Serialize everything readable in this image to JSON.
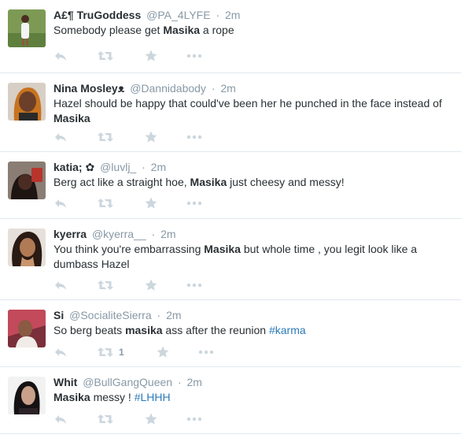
{
  "tweets": [
    {
      "fullname": "A£¶ TruGoddess",
      "username": "@PA_4LYFE",
      "time": "2m",
      "segments": [
        {
          "t": "Somebody please get "
        },
        {
          "t": "Masika",
          "b": true
        },
        {
          "t": " a rope"
        }
      ],
      "retweet_count": ""
    },
    {
      "fullname": "Nina Mosleyᴥ",
      "username": "@Dannidabody",
      "time": "2m",
      "segments": [
        {
          "t": "Hazel should be happy that could've been her he punched in the face instead of "
        },
        {
          "t": "Masika",
          "b": true
        }
      ],
      "retweet_count": ""
    },
    {
      "fullname": "katia; ✿",
      "username": "@luvlj_",
      "time": "2m",
      "segments": [
        {
          "t": "Berg act like a straight hoe, "
        },
        {
          "t": "Masika",
          "b": true
        },
        {
          "t": " just cheesy and messy!"
        }
      ],
      "retweet_count": ""
    },
    {
      "fullname": "kyerra",
      "username": "@kyerra__",
      "time": "2m",
      "segments": [
        {
          "t": "You think you're embarrassing "
        },
        {
          "t": "Masika",
          "b": true
        },
        {
          "t": " but whole time , you legit look like a dumbass Hazel"
        }
      ],
      "retweet_count": ""
    },
    {
      "fullname": "Si",
      "username": "@SocialiteSierra",
      "time": "2m",
      "segments": [
        {
          "t": "So berg beats "
        },
        {
          "t": "masika",
          "b": true
        },
        {
          "t": " ass after the reunion "
        },
        {
          "t": "#karma",
          "tag": true
        }
      ],
      "retweet_count": "1"
    },
    {
      "fullname": "Whit",
      "username": "@BullGangQueen",
      "time": "2m",
      "segments": [
        {
          "t": "Masika",
          "b": true
        },
        {
          "t": " messy ! "
        },
        {
          "t": "#LHHH",
          "tag": true
        }
      ],
      "retweet_count": ""
    }
  ],
  "icons": {
    "reply": "reply-icon",
    "retweet": "retweet-icon",
    "favorite": "star-icon",
    "more": "more-icon"
  },
  "colors": {
    "text": "#292f33",
    "muted": "#8899a6",
    "icon": "#ccd6dd",
    "link": "#2b7bb9",
    "divider": "#e1e8ed"
  }
}
